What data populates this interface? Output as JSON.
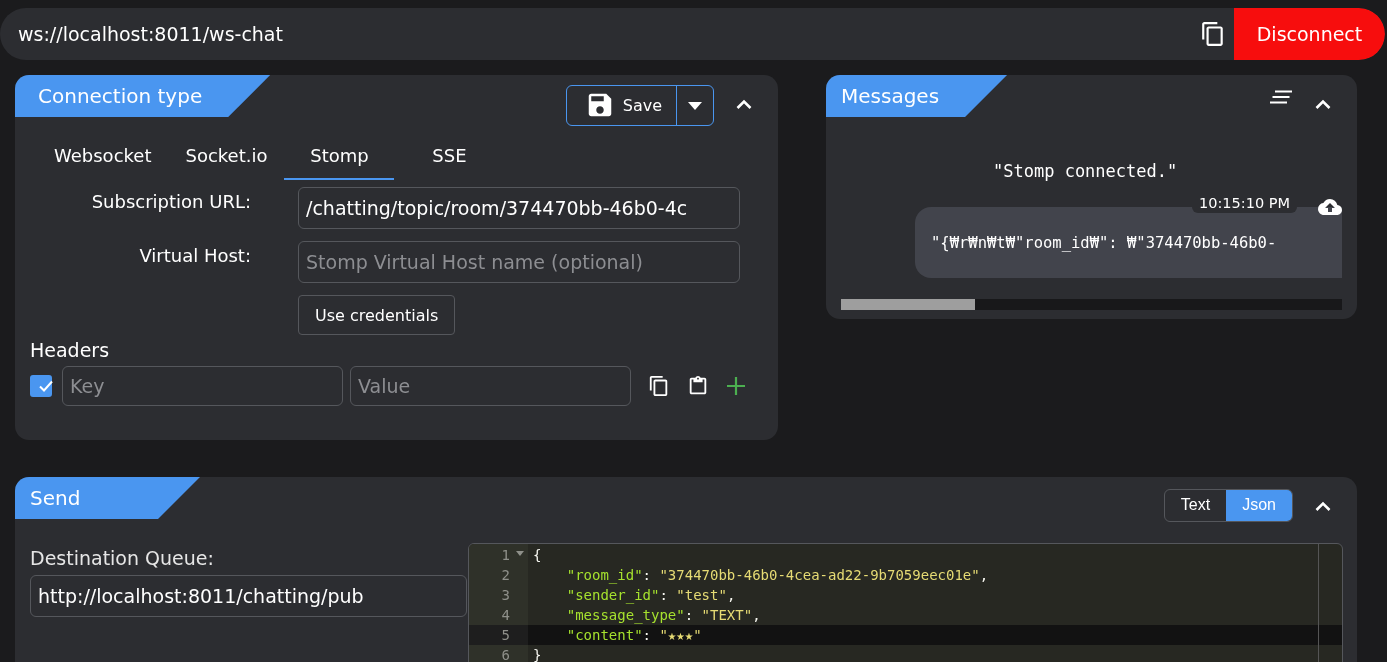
{
  "url_bar": {
    "value": "ws://localhost:8011/ws-chat",
    "disconnect_label": "Disconnect"
  },
  "connection": {
    "title": "Connection type",
    "save_label": "Save",
    "tabs": [
      {
        "label": "Websocket",
        "selected": false
      },
      {
        "label": "Socket.io",
        "selected": false
      },
      {
        "label": "Stomp",
        "selected": true
      },
      {
        "label": "SSE",
        "selected": false
      }
    ],
    "subscription_label": "Subscription URL:",
    "subscription_value": "/chatting/topic/room/374470bb-46b0-4c",
    "vhost_label": "Virtual Host:",
    "vhost_placeholder": "Stomp Virtual Host name (optional)",
    "credentials_label": "Use credentials",
    "headers_label": "Headers",
    "header_row": {
      "checked": true,
      "key_placeholder": "Key",
      "value_placeholder": "Value"
    }
  },
  "messages": {
    "title": "Messages",
    "items": [
      {
        "kind": "system",
        "text": "\"Stomp connected.\""
      },
      {
        "kind": "sent",
        "time": "10:15:10 PM",
        "text": "\"{₩r₩n₩t₩\"room_id₩\": ₩\"374470bb-46b0-"
      }
    ]
  },
  "send": {
    "title": "Send",
    "destination_label": "Destination Queue:",
    "destination_value": "http://localhost:8011/chatting/pub",
    "modes": [
      {
        "label": "Text",
        "selected": false
      },
      {
        "label": "Json",
        "selected": true
      }
    ],
    "editor": [
      {
        "number": "1",
        "active": false,
        "tokens": [
          {
            "kind": "punct",
            "text": "{"
          }
        ]
      },
      {
        "number": "2",
        "active": false,
        "tokens": [
          {
            "kind": "key",
            "text": "    \"room_id\""
          },
          {
            "kind": "punct",
            "text": ": "
          },
          {
            "kind": "string",
            "text": "\"374470bb-46b0-4cea-ad22-9b7059eec01e\""
          },
          {
            "kind": "punct",
            "text": ","
          }
        ]
      },
      {
        "number": "3",
        "active": false,
        "tokens": [
          {
            "kind": "key",
            "text": "    \"sender_id\""
          },
          {
            "kind": "punct",
            "text": ": "
          },
          {
            "kind": "string",
            "text": "\"test\""
          },
          {
            "kind": "punct",
            "text": ","
          }
        ]
      },
      {
        "number": "4",
        "active": false,
        "tokens": [
          {
            "kind": "key",
            "text": "    \"message_type\""
          },
          {
            "kind": "punct",
            "text": ": "
          },
          {
            "kind": "string",
            "text": "\"TEXT\""
          },
          {
            "kind": "punct",
            "text": ","
          }
        ]
      },
      {
        "number": "5",
        "active": true,
        "tokens": [
          {
            "kind": "key",
            "text": "    \"content\""
          },
          {
            "kind": "punct",
            "text": ": "
          },
          {
            "kind": "string",
            "text": "\"★★★\""
          }
        ]
      },
      {
        "number": "6",
        "active": false,
        "tokens": [
          {
            "kind": "punct",
            "text": "}"
          }
        ]
      }
    ]
  }
}
